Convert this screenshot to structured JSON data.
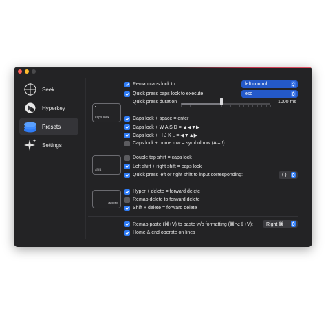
{
  "sidebar": {
    "items": [
      {
        "label": "Seek",
        "icon": "crosshair-icon"
      },
      {
        "label": "Hyperkey",
        "icon": "hyperkey-icon"
      },
      {
        "label": "Presets",
        "icon": "presets-icon",
        "active": true
      },
      {
        "label": "Settings",
        "icon": "sparkle-icon"
      }
    ]
  },
  "colors": {
    "accent": "#2f7cf6",
    "window_bg": "#232325",
    "select_bg": "#2459c9"
  },
  "section1": {
    "keycap_label": "caps lock",
    "remap_caps": {
      "label": "Remap caps lock to:",
      "checked": true,
      "value": "left control"
    },
    "quick_press": {
      "label": "Quick press caps lock to execute:",
      "checked": true,
      "value": "esc"
    },
    "duration": {
      "label": "Quick press duration",
      "value_text": "1000 ms",
      "value_fraction": 0.45
    },
    "options": [
      {
        "label": "Caps lock + space = enter",
        "checked": true
      },
      {
        "label": "Caps lock + W A S D = ▲◀▼▶",
        "checked": true
      },
      {
        "label": "Caps lock + H J K L = ◀▼▲▶",
        "checked": true
      },
      {
        "label": "Caps lock + home row = symbol row (A = !)",
        "checked": false
      }
    ]
  },
  "section2": {
    "keycap_label": "shift",
    "options": [
      {
        "label": "Double tap shift = caps lock",
        "checked": false
      },
      {
        "label": "Left shift + right shift = caps lock",
        "checked": true
      },
      {
        "label": "Quick press left or right shift to input corresponding:",
        "checked": true
      }
    ],
    "select_value": "( )"
  },
  "section3": {
    "keycap_label": "delete",
    "options": [
      {
        "label": "Hyper + delete = forward delete",
        "checked": true
      },
      {
        "label": "Remap delete to forward delete",
        "checked": false
      },
      {
        "label": "Shift + delete = forward delete",
        "checked": true
      }
    ]
  },
  "section4": {
    "paste": {
      "label": "Remap paste (⌘+V) to paste w/o formatting (⌘⌥⇧+V):",
      "checked": true,
      "value": "Right ⌘"
    },
    "home_end": {
      "label": "Home & end operate on lines",
      "checked": true
    }
  }
}
